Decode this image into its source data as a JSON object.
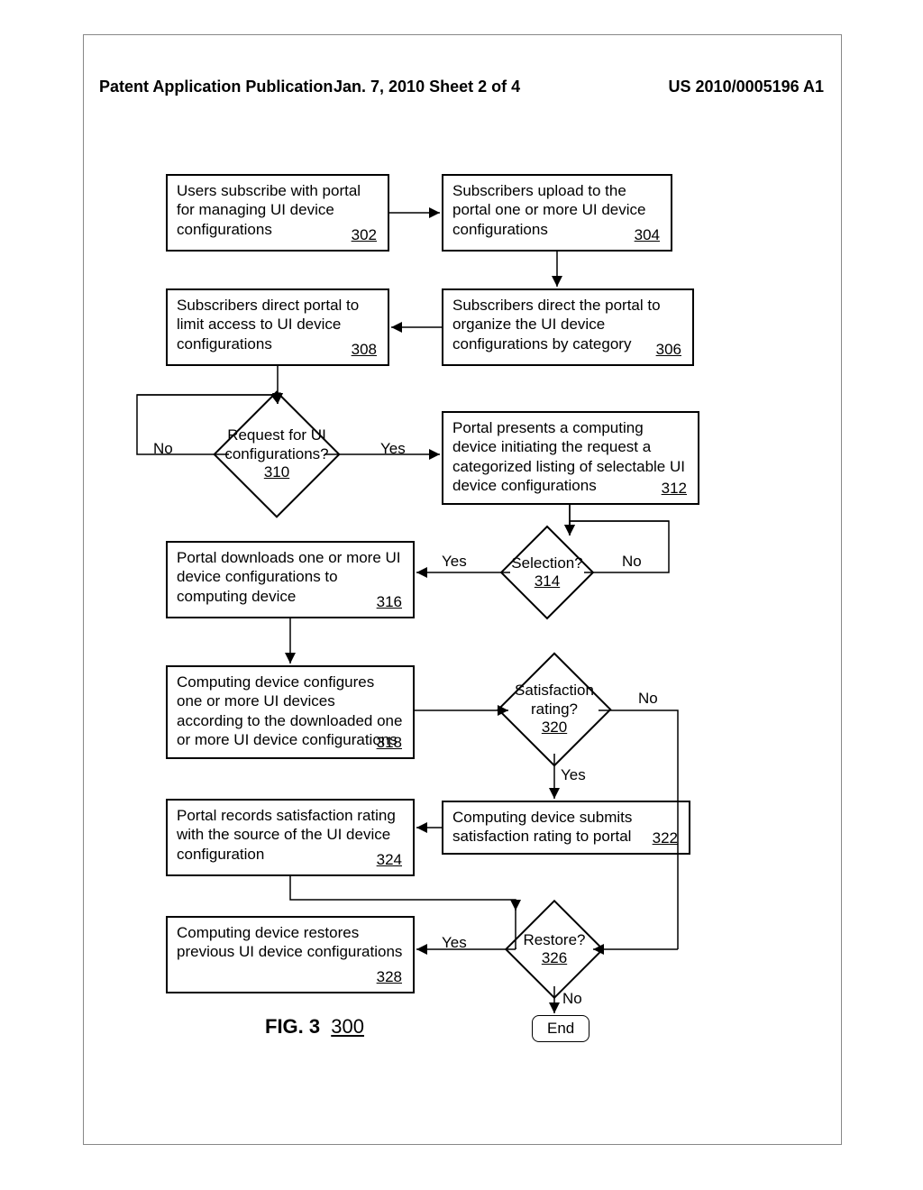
{
  "header": {
    "left": "Patent Application Publication",
    "center": "Jan. 7, 2010  Sheet 2 of 4",
    "right": "US 2010/0005196 A1"
  },
  "boxes": {
    "b302": {
      "text": "Users subscribe with portal for managing UI device configurations",
      "ref": "302"
    },
    "b304": {
      "text": "Subscribers upload to the portal one or more UI device configurations",
      "ref": "304"
    },
    "b306": {
      "text": "Subscribers direct the portal to organize the UI device configurations by category",
      "ref": "306"
    },
    "b308": {
      "text": "Subscribers direct portal to limit access to UI device configurations",
      "ref": "308"
    },
    "b312": {
      "text": "Portal presents a computing device initiating the request a categorized listing of selectable UI device configurations",
      "ref": "312"
    },
    "b316": {
      "text": "Portal downloads one or more UI device configurations to computing device",
      "ref": "316"
    },
    "b318": {
      "text": "Computing device configures one or more UI devices according to the downloaded one or more UI device configurations",
      "ref": "318"
    },
    "b322": {
      "text": "Computing device submits satisfaction rating to portal",
      "ref": "322"
    },
    "b324": {
      "text": "Portal records satisfaction rating with the source of the UI device configuration",
      "ref": "324"
    },
    "b328": {
      "text": "Computing device restores previous UI device configurations",
      "ref": "328"
    }
  },
  "diamonds": {
    "d310": {
      "line1": "Request for UI",
      "line2": "configurations?",
      "ref": "310"
    },
    "d314": {
      "line1": "Selection?",
      "ref": "314"
    },
    "d320": {
      "line1": "Satisfaction",
      "line2": "rating?",
      "ref": "320"
    },
    "d326": {
      "line1": "Restore?",
      "ref": "326"
    }
  },
  "labels": {
    "no": "No",
    "yes": "Yes",
    "end": "End"
  },
  "figure": {
    "label": "FIG. 3",
    "ref": "300"
  }
}
